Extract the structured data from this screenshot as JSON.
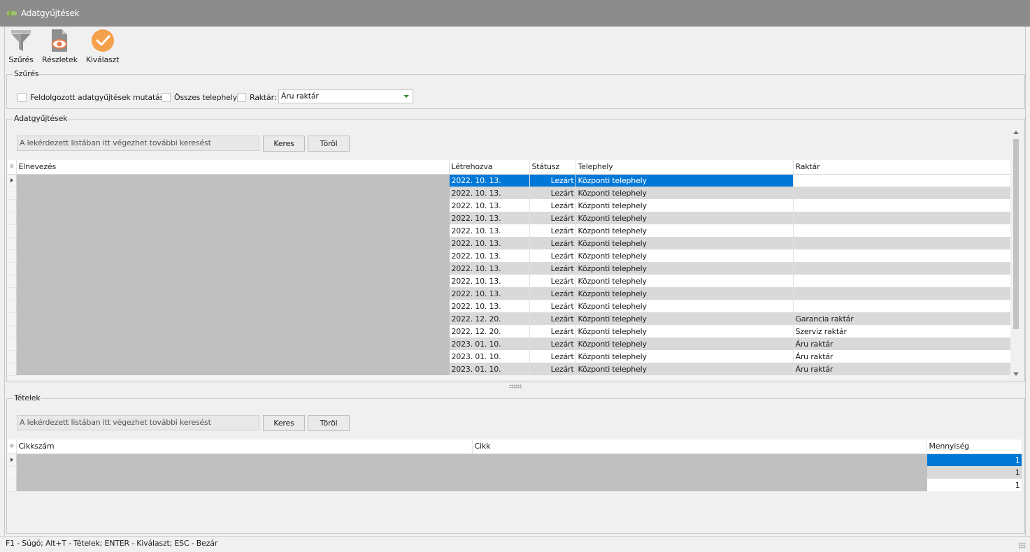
{
  "window": {
    "title": "Adatgyűjtések"
  },
  "toolbar": {
    "filter_label": "Szűrés",
    "details_label": "Részletek",
    "select_label": "Kiválaszt"
  },
  "filter_group": {
    "caption": "Szűrés",
    "show_processed_label": "Feldolgozott adatgyűjtések mutatása",
    "all_sites_label": "Összes telephely",
    "warehouse_label": "Raktár:",
    "warehouse_value": "Áru raktár"
  },
  "collections": {
    "caption": "Adatgyűjtések",
    "search_placeholder": "A lekérdezett listában itt végezhet további keresést",
    "search_button": "Keres",
    "clear_button": "Töröl",
    "columns": {
      "name": "Elnevezés",
      "created": "Létrehozva",
      "status": "Státusz",
      "site": "Telephely",
      "warehouse": "Raktár"
    },
    "rows": [
      {
        "created": "2022. 10. 13.",
        "status": "Lezárt",
        "site": "Központi telephely",
        "warehouse": ""
      },
      {
        "created": "2022. 10. 13.",
        "status": "Lezárt",
        "site": "Központi telephely",
        "warehouse": ""
      },
      {
        "created": "2022. 10. 13.",
        "status": "Lezárt",
        "site": "Központi telephely",
        "warehouse": ""
      },
      {
        "created": "2022. 10. 13.",
        "status": "Lezárt",
        "site": "Központi telephely",
        "warehouse": ""
      },
      {
        "created": "2022. 10. 13.",
        "status": "Lezárt",
        "site": "Központi telephely",
        "warehouse": ""
      },
      {
        "created": "2022. 10. 13.",
        "status": "Lezárt",
        "site": "Központi telephely",
        "warehouse": ""
      },
      {
        "created": "2022. 10. 13.",
        "status": "Lezárt",
        "site": "Központi telephely",
        "warehouse": ""
      },
      {
        "created": "2022. 10. 13.",
        "status": "Lezárt",
        "site": "Központi telephely",
        "warehouse": ""
      },
      {
        "created": "2022. 10. 13.",
        "status": "Lezárt",
        "site": "Központi telephely",
        "warehouse": ""
      },
      {
        "created": "2022. 10. 13.",
        "status": "Lezárt",
        "site": "Központi telephely",
        "warehouse": ""
      },
      {
        "created": "2022. 10. 13.",
        "status": "Lezárt",
        "site": "Központi telephely",
        "warehouse": ""
      },
      {
        "created": "2022. 12. 20.",
        "status": "Lezárt",
        "site": "Központi telephely",
        "warehouse": "Garancia raktár"
      },
      {
        "created": "2022. 12. 20.",
        "status": "Lezárt",
        "site": "Központi telephely",
        "warehouse": "Szerviz raktár"
      },
      {
        "created": "2023. 01. 10.",
        "status": "Lezárt",
        "site": "Központi telephely",
        "warehouse": "Áru raktár"
      },
      {
        "created": "2023. 01. 10.",
        "status": "Lezárt",
        "site": "Központi telephely",
        "warehouse": "Áru raktár"
      },
      {
        "created": "2023. 01. 10.",
        "status": "Lezárt",
        "site": "Központi telephely",
        "warehouse": "Áru raktár"
      }
    ]
  },
  "items": {
    "caption": "Tételek",
    "search_placeholder": "A lekérdezett listában itt végezhet további keresést",
    "search_button": "Keres",
    "clear_button": "Töröl",
    "columns": {
      "code": "Cikkszám",
      "item": "Cikk",
      "quantity": "Mennyiség"
    },
    "rows": [
      {
        "quantity": "1"
      },
      {
        "quantity": "1"
      },
      {
        "quantity": "1"
      }
    ]
  },
  "status_bar": {
    "text": "F1 - Súgó; Alt+T - Tételek; ENTER - Kiválaszt; ESC - Bezár"
  },
  "colors": {
    "title_bar": "#8c8c8c",
    "selection": "#0078d7",
    "select_icon": "#f5a04a",
    "redacted": "#c0c0c0"
  }
}
